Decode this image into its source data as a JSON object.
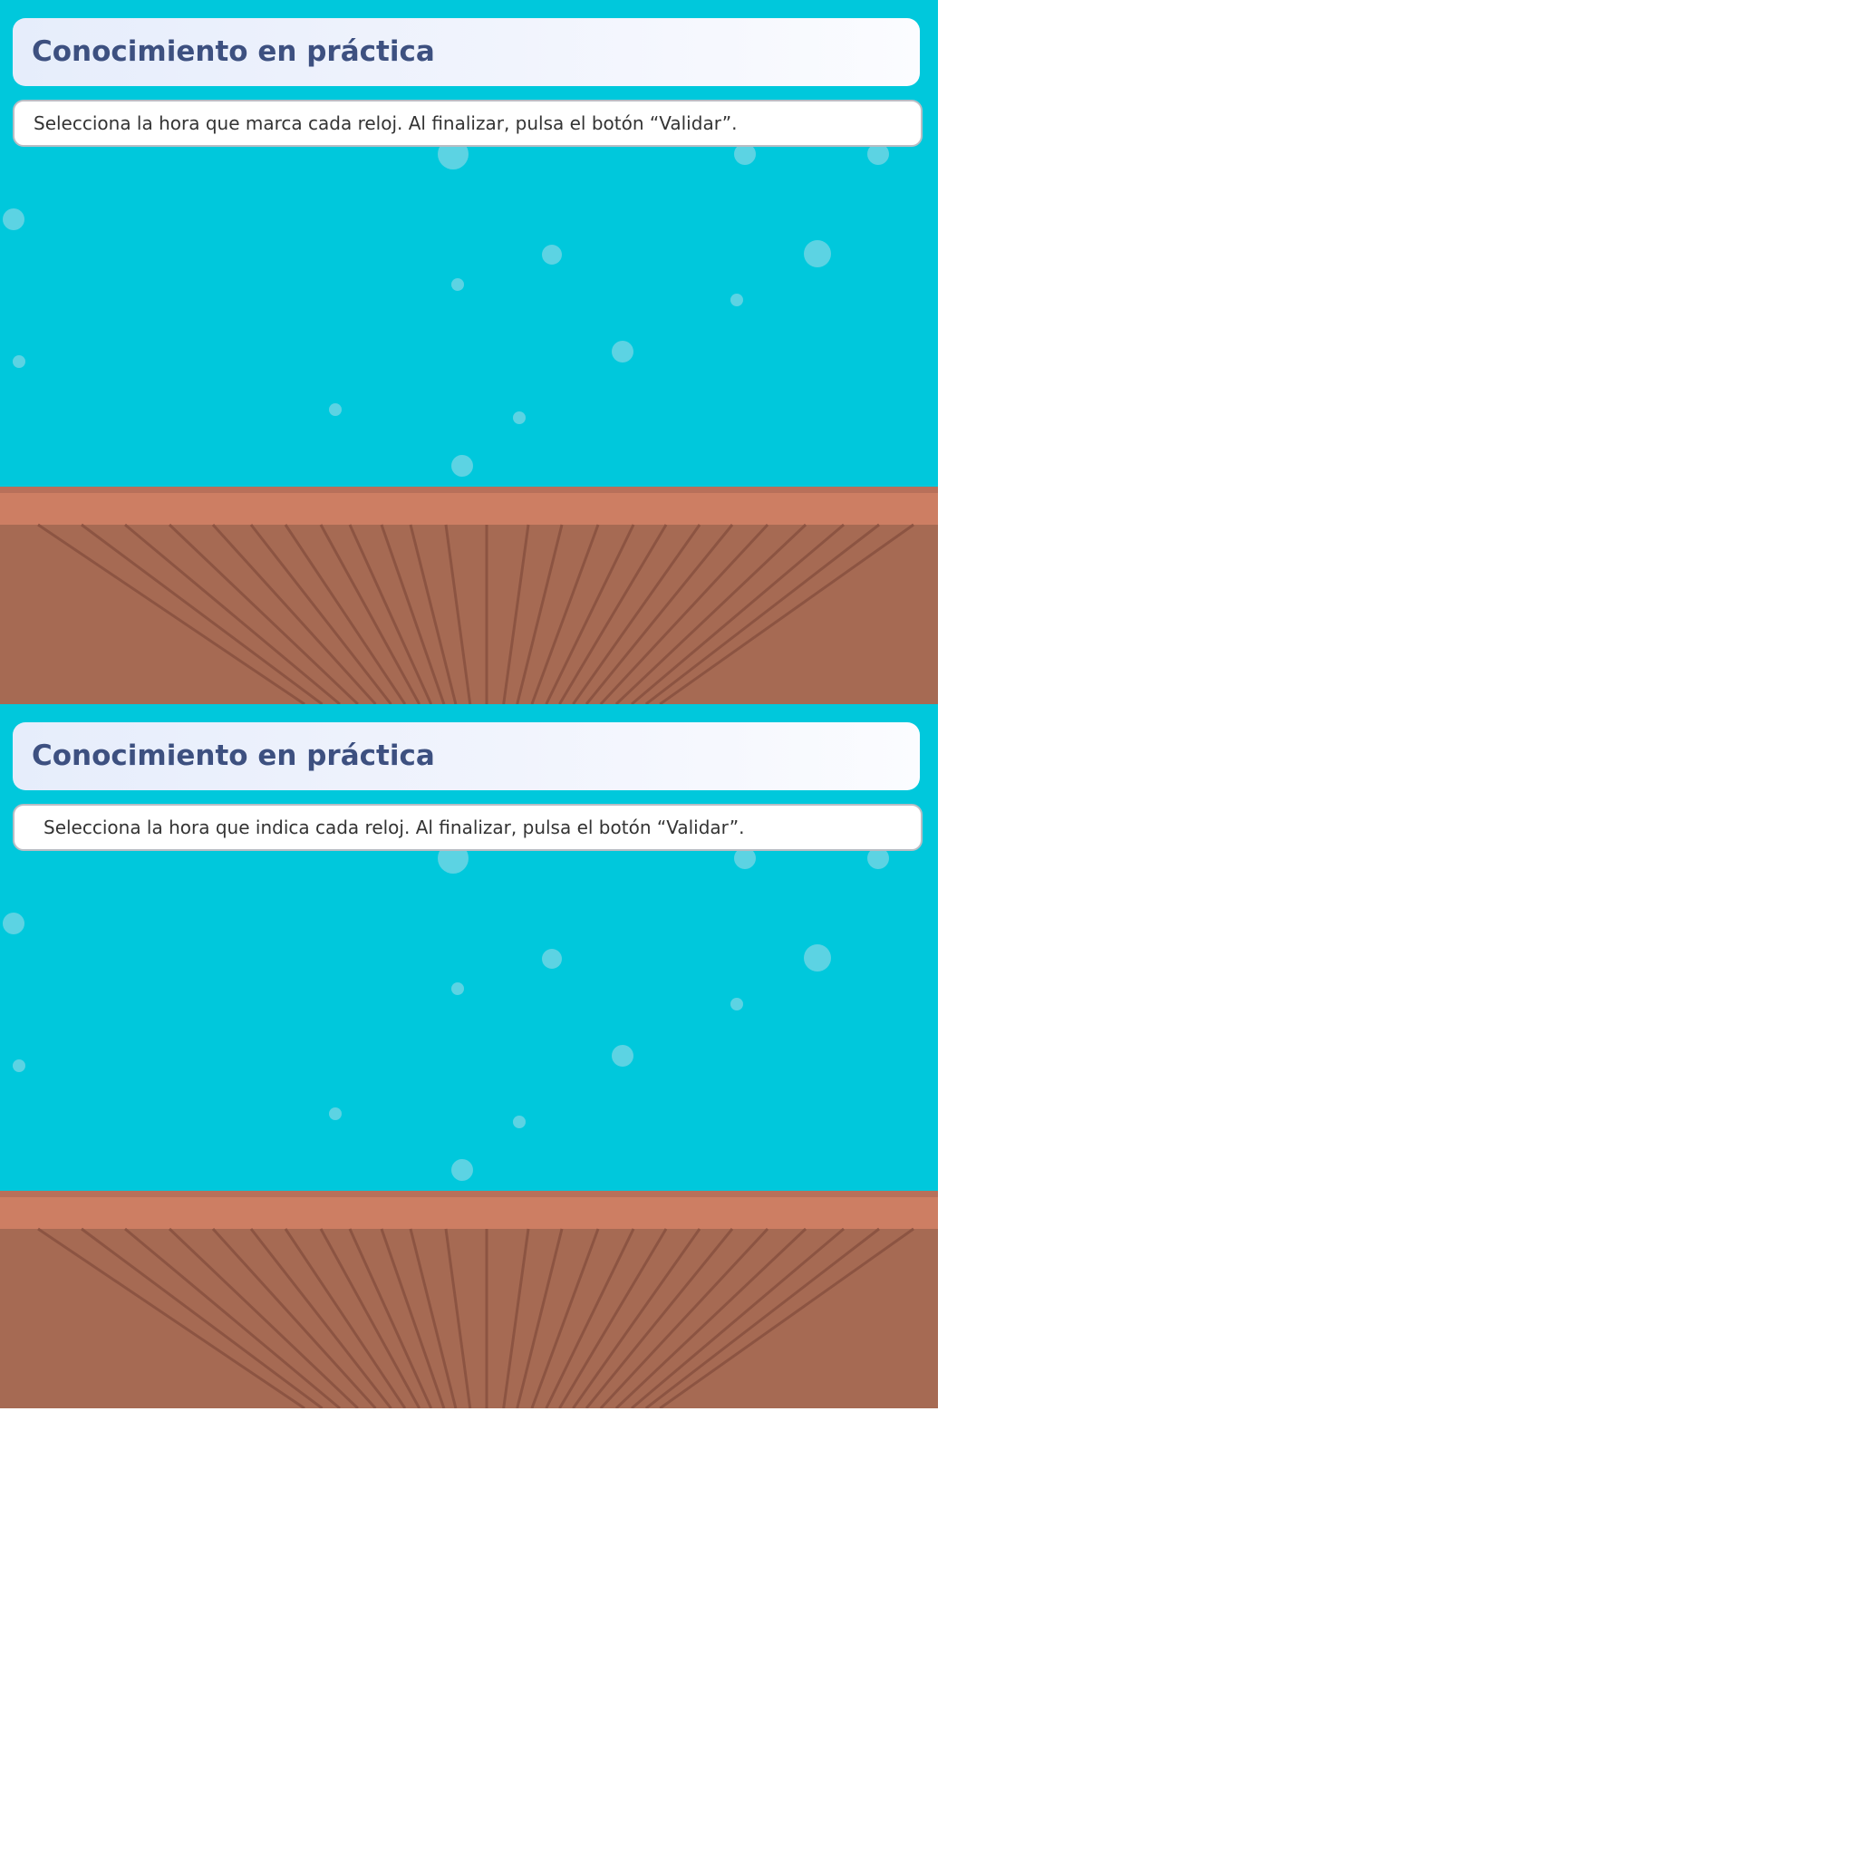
{
  "panels": [
    {
      "title": "Conocimiento en práctica",
      "instruction": "Selecciona la hora que marca cada reloj. Al finalizar, pulsa el botón “Validar”."
    },
    {
      "title": "Conocimiento en práctica",
      "instruction": "Selecciona la hora que indica cada reloj. Al finalizar, pulsa el botón “Validar”."
    }
  ],
  "colors": {
    "background_water": "#00c8dc",
    "title_text": "#3d5080",
    "bubble": "#5cd3e3",
    "floor_top_line": "#b8705a",
    "floor_edge": "#cd7e63",
    "floor_boards": "#a66a53",
    "floor_board_lines": "#8c5442"
  }
}
